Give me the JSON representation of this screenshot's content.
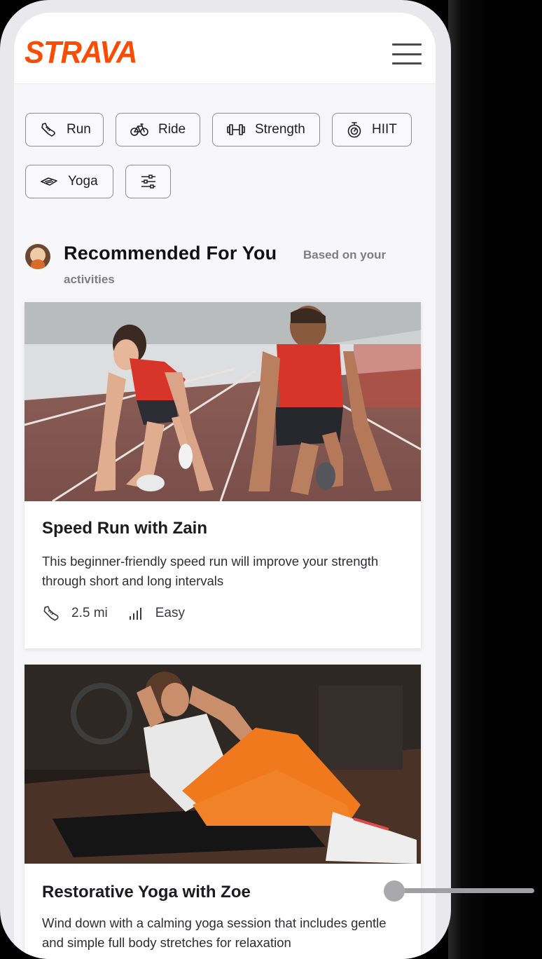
{
  "header": {
    "logo_text": "STRAVA",
    "menu_icon": "hamburger-menu-icon"
  },
  "filters": [
    {
      "label": "Run",
      "icon": "running-shoe-icon"
    },
    {
      "label": "Ride",
      "icon": "bicycle-icon"
    },
    {
      "label": "Strength",
      "icon": "dumbbell-icon"
    },
    {
      "label": "HIIT",
      "icon": "stopwatch-icon"
    },
    {
      "label": "Yoga",
      "icon": "yoga-mat-icon"
    },
    {
      "label": "",
      "icon": "filter-sliders-icon"
    }
  ],
  "recommended": {
    "title": "Recommended For You",
    "subtitle_line1": "Based on your",
    "subtitle_line2": "activities"
  },
  "cards": [
    {
      "title": "Speed Run with Zain",
      "description": "This beginner-friendly speed run will improve your strength through short and long intervals",
      "distance": "2.5 mi",
      "level": "Easy",
      "image": "two runners crouched at start line on indoor track"
    },
    {
      "title": "Restorative Yoga with Zoe",
      "description": "Wind down with a calming yoga session that includes gentle and simple full body stretches for relaxation",
      "image": "woman doing sit-ups on a mat in a gym"
    }
  ],
  "colors": {
    "brand": "#fc4c02",
    "chip_border": "#8d8d93",
    "background": "#f7f7f9"
  }
}
